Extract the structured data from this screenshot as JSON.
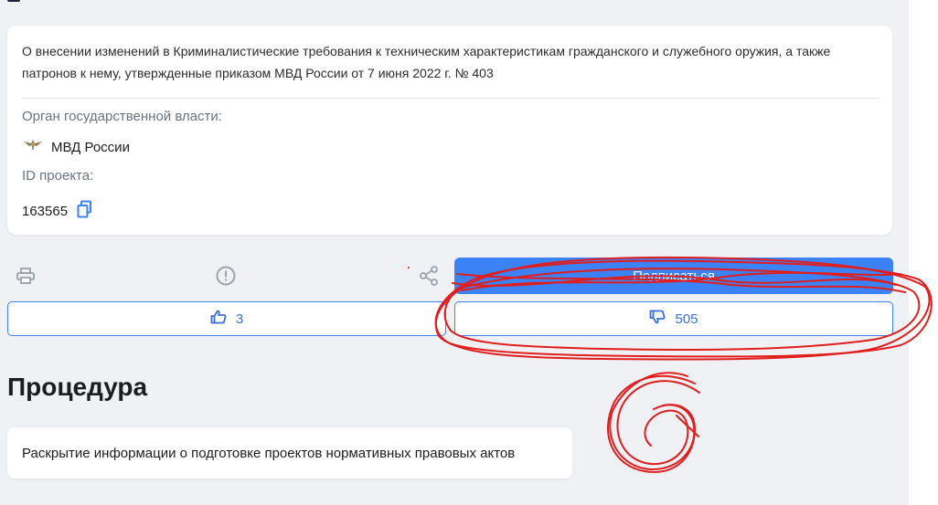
{
  "project": {
    "title": "О внесении изменений в Криминалистические требования к техническим характеристикам гражданского и служебного оружия, а также патронов к нему, утвержденные приказом МВД России от 7 июня 2022 г. № 403",
    "authority_label": "Орган государственной власти:",
    "authority_name": "МВД России",
    "id_label": "ID проекта:",
    "id_value": "163565"
  },
  "actions": {
    "subscribe_label": "Подписаться",
    "likes_count": "3",
    "dislikes_count": "505"
  },
  "procedure": {
    "heading": "Процедура",
    "description": "Раскрытие информации о подготовке проектов нормативных правовых актов"
  },
  "icons": {
    "print": "print-icon",
    "report": "exclamation-circle-icon",
    "share": "share-icon",
    "copy": "copy-icon",
    "like": "thumbs-up-icon",
    "dislike": "thumbs-down-icon",
    "emblem": "mvd-emblem-icon"
  },
  "colors": {
    "accent": "#3b82f6",
    "annotation": "#e11d1d"
  }
}
